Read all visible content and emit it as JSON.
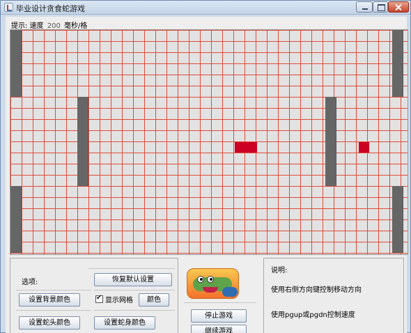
{
  "window": {
    "title": "毕业设计贪食蛇游戏"
  },
  "hint": {
    "prefix": "提示:",
    "speed_label": "速度",
    "speed_value": "200",
    "speed_unit": "毫秒/格"
  },
  "board": {
    "show_grid": true,
    "colors": {
      "background": "#e2e2e2",
      "grid": "#e04b3a",
      "wall": "#666666",
      "food": "#cc0022"
    }
  },
  "options": {
    "title": "选项:",
    "restore_defaults_label": "恢复默认设置",
    "set_background_color_label": "设置背景颜色",
    "show_grid_label": "显示网格",
    "grid_color_label": "颜色",
    "set_head_color_label": "设置蛇头颜色",
    "set_body_color_label": "设置蛇身颜色"
  },
  "controls": {
    "stop_game_label": "停止游戏",
    "continue_game_label": "继续游戏"
  },
  "description": {
    "title": "说明:",
    "line1": "使用右侧方向键控制移动方向",
    "line2": "使用pgup或pgdn控制速度"
  },
  "icons": {
    "app": "java-cup-icon",
    "logo": "snake-logo-icon"
  }
}
